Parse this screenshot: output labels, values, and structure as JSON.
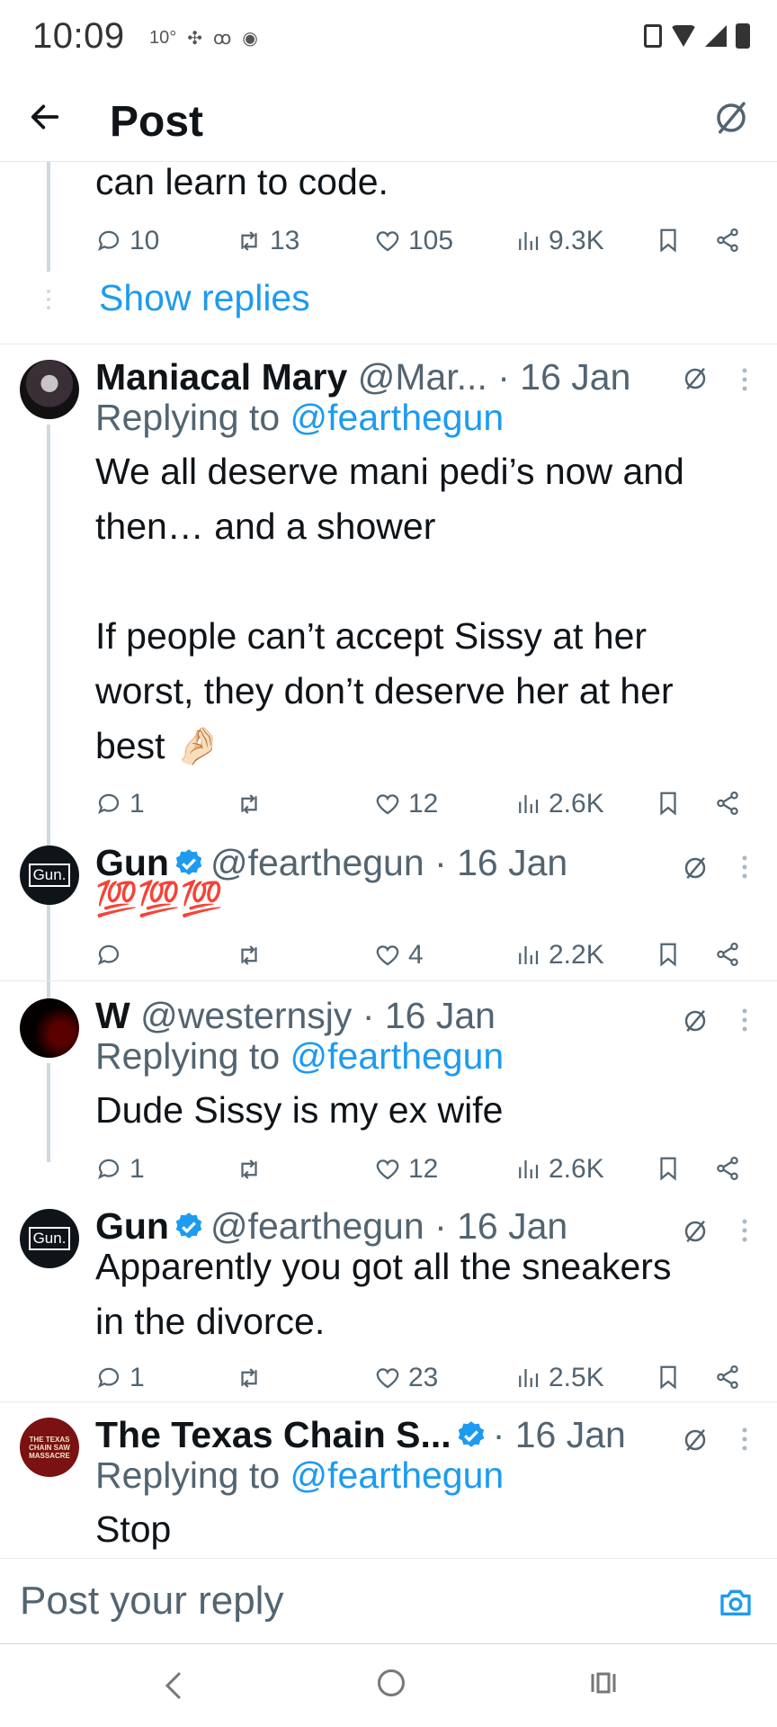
{
  "status_bar": {
    "time": "10:09",
    "left_icons": [
      "10°",
      "pinwheel-icon",
      "voicemail-icon",
      "eye-icon"
    ],
    "right_icons": [
      "vibrate-icon",
      "wifi-icon",
      "signal-icon",
      "battery-icon"
    ]
  },
  "header": {
    "title": "Post",
    "back_icon": "arrow-left-icon",
    "right_icon": "grok-icon"
  },
  "thread": {
    "partial_post": {
      "text": "can learn to code.",
      "stats": {
        "replies": "10",
        "reposts": "13",
        "likes": "105",
        "views": "9.3K"
      },
      "show_replies": "Show replies"
    },
    "posts": [
      {
        "name": "Maniacal Mary",
        "handle": "@Mar...",
        "date": "· 16 Jan",
        "replying_label": "Replying to",
        "replying_to": "@fearthegun",
        "lines": [
          "We all deserve mani pedi’s now and",
          "then… and a shower",
          "",
          "If people can’t accept Sissy at her",
          "worst, they don’t deserve her at her",
          "best"
        ],
        "emoji": "🤌🏻",
        "stats": {
          "replies": "1",
          "reposts": "",
          "likes": "12",
          "views": "2.6K"
        }
      },
      {
        "name": "Gun",
        "verified": true,
        "handle": "@fearthegun",
        "date": "· 16 Jan",
        "text": "💯💯💯",
        "stats": {
          "replies": "",
          "reposts": "",
          "likes": "4",
          "views": "2.2K"
        },
        "avatar_text": "Gun."
      },
      {
        "name": "W",
        "handle": "@westernsjy",
        "date": "· 16 Jan",
        "replying_label": "Replying to",
        "replying_to": "@fearthegun",
        "text": "Dude Sissy is my ex wife",
        "stats": {
          "replies": "1",
          "reposts": "",
          "likes": "12",
          "views": "2.6K"
        }
      },
      {
        "name": "Gun",
        "verified": true,
        "handle": "@fearthegun",
        "date": "· 16 Jan",
        "lines": [
          "Apparently you got all the sneakers",
          "in the divorce."
        ],
        "stats": {
          "replies": "1",
          "reposts": "",
          "likes": "23",
          "views": "2.5K"
        },
        "avatar_text": "Gun."
      },
      {
        "name": "The Texas Chain S...",
        "verified": true,
        "handle": "",
        "date": "· 16 Jan",
        "replying_label": "Replying to",
        "replying_to": "@fearthegun",
        "text": "Stop",
        "avatar_lines": [
          "THE TEXAS",
          "CHAIN SAW",
          "MASSACRE"
        ]
      }
    ]
  },
  "reply_bar": {
    "placeholder": "Post your reply",
    "icon": "camera-icon"
  },
  "nav_bar": {
    "icons": [
      "nav-back-icon",
      "nav-home-icon",
      "nav-recents-icon"
    ]
  },
  "colors": {
    "accent": "#1d9bf0",
    "text": "#0f1419",
    "muted": "#536471",
    "divider": "#e6e9ec"
  }
}
